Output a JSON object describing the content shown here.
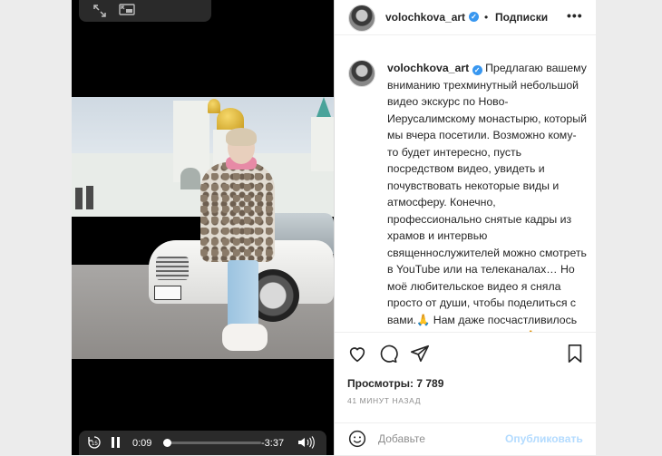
{
  "post": {
    "username": "volochkova_art",
    "follow_separator": "•",
    "follow_label": "Подписки",
    "more_icon": "more-horizontal-icon",
    "caption_username": "volochkova_art",
    "caption_text": "Предлагаю вашему вниманию трехминутный небольшой видео экскурс по Ново-Иерусалимскому монастырю, который мы вчера посетили. Возможно кому-то будет интересно, пусть посредством видео, увидеть и почувствовать некоторые виды и атмосферу. Конечно, профессионально снятые кадры из храмов и интервью священнослужителей можно смотреть в YouTube или на телеканалах… Но моё любительское видео я сняла просто от души, чтобы поделиться с вами.🙏 Нам даже посчастливилось подняться на колокольню.🙏 Многие кадры снимал мой добрый друг Дима. Я",
    "views_label": "Просмотры: 7 789",
    "time_ago": "41 МИНУТ НАЗАД",
    "comment_placeholder": "Добавьте",
    "publish_label": "Опубликовать"
  },
  "video": {
    "current_time": "0:09",
    "remaining_time": "-3:37",
    "progress_fraction": 0.04,
    "top_icons": [
      "expand-icon",
      "picture-in-picture-icon"
    ],
    "bottom_icons": [
      "rewind-15-icon",
      "pause-icon",
      "volume-icon"
    ]
  },
  "colors": {
    "verified": "#3897f0",
    "publish_disabled": "#b3dbff",
    "text": "#262626",
    "muted": "#8e8e8e"
  }
}
